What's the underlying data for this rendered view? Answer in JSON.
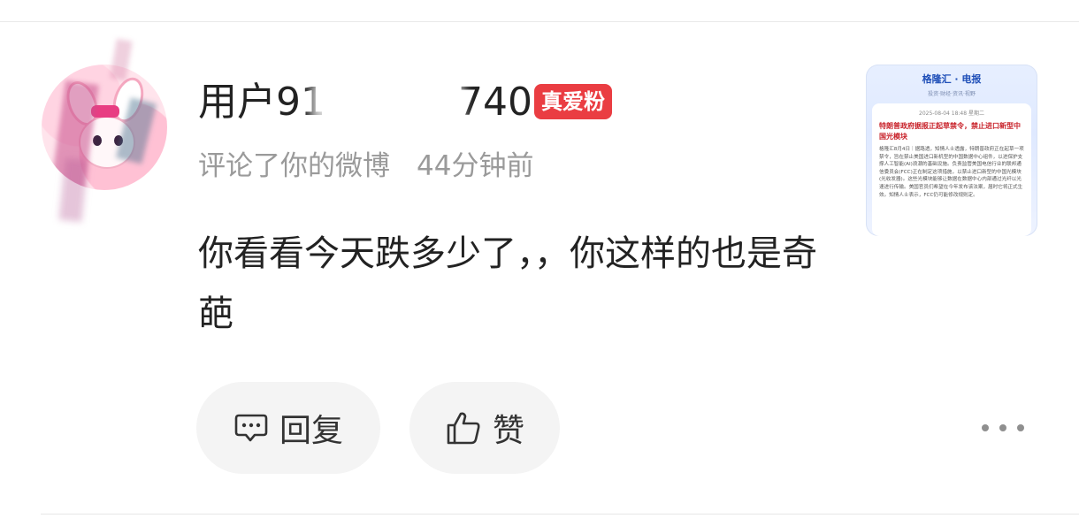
{
  "comment": {
    "username": "用户91",
    "username_tail": "740",
    "fan_badge": "真爱粉",
    "action": "评论了你的微博",
    "time": "44分钟前",
    "text": "你看看今天跌多少了，，你这样的也是奇葩"
  },
  "actions": {
    "reply_label": "回复",
    "like_label": "赞"
  },
  "thumbnail": {
    "brand": "格隆汇 · 电报",
    "brand_sub": "投资·财经·资讯·视野",
    "date": "2025-08-04 18:48 星期二",
    "headline": "特朗普政府据报正起草禁令，禁止进口新型中国光模块",
    "body": "格隆汇8月4日｜据路透，知情人士透露，特朗普政府正在起草一项禁令，旨在禁止美国进口新机型的中国数据中心组件，以进保护支撑人工智能(AI)浪潮的基础设施。负责监管美国电信行业的联邦通信委员会(FCC)正在制定这项措施，以禁止进口新型的中国光模块(光收发器)。这些光模块能够让数据在数据中心内部通过光纤以光速进行传输。美国官员们希望在今年发布该法案，届时它将正式生效。知情人士表示，FCC仍可能修改规则定。"
  },
  "colors": {
    "badge": "#ea3d42",
    "meta": "#9a9a9a",
    "pill": "#f4f4f4"
  }
}
